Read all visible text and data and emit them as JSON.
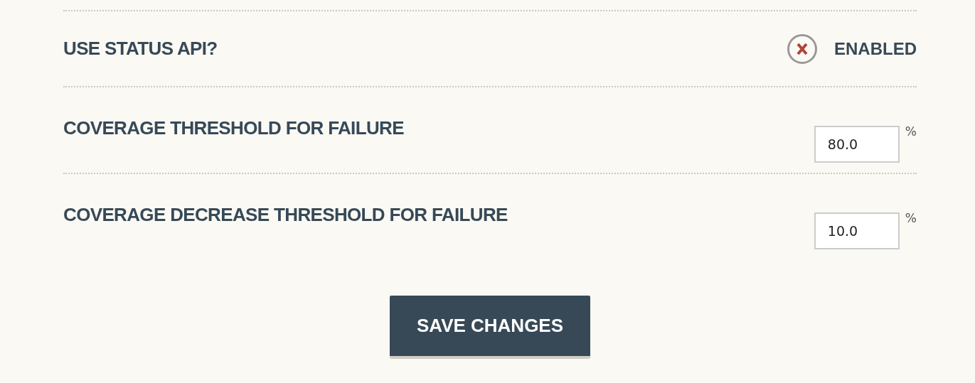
{
  "settings": [
    {
      "kind": "toggle",
      "label": "USE STATUS API?",
      "toggle_label": "ENABLED",
      "on": false
    },
    {
      "kind": "number",
      "label": "COVERAGE THRESHOLD FOR FAILURE",
      "value": "80.0",
      "unit": "%"
    },
    {
      "kind": "number",
      "label": "COVERAGE DECREASE THRESHOLD FOR FAILURE",
      "value": "10.0",
      "unit": "%"
    }
  ],
  "save_button": "SAVE CHANGES"
}
